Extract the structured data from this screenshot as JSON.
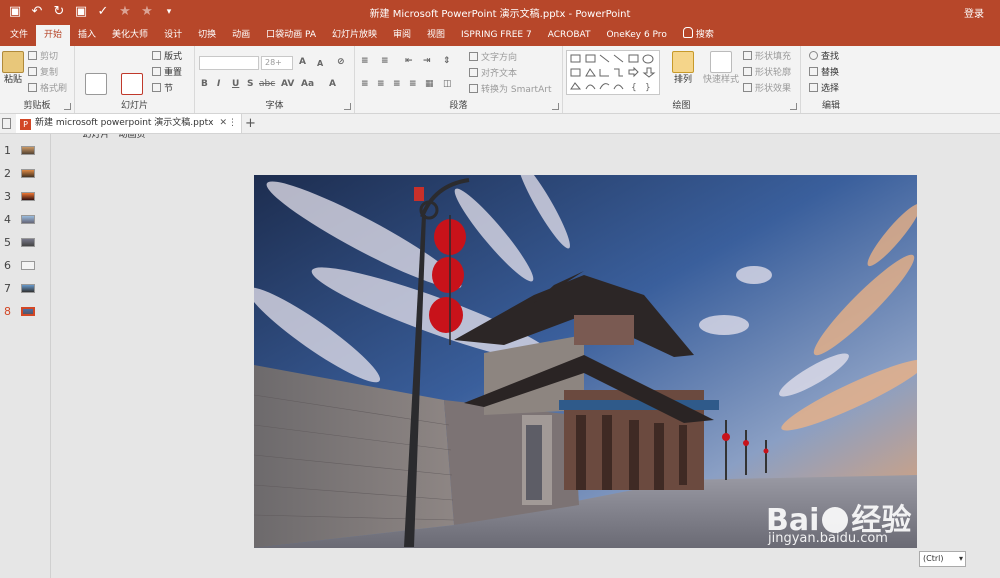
{
  "window": {
    "title": "新建 Microsoft PowerPoint 演示文稿.pptx  -  PowerPoint",
    "login": "登录"
  },
  "qat": {
    "save": "▣",
    "undo": "↶",
    "redo": "↻"
  },
  "tabs": [
    "文件",
    "开始",
    "插入",
    "美化大师",
    "设计",
    "切换",
    "动画",
    "口袋动画 PA",
    "幻灯片放映",
    "审阅",
    "视图",
    "ISPRING FREE 7",
    "ACROBAT",
    "OneKey 6 Pro",
    "搜索"
  ],
  "ribbon": {
    "clipboard": {
      "paste": "粘贴",
      "cut": "剪切",
      "copy": "复制",
      "format_painter": "格式刷",
      "label": "剪贴板"
    },
    "slides": {
      "new_slide": "新建\n幻灯片",
      "add_slide": "新加\n动画页",
      "layout": "版式",
      "reset": "重置",
      "section": "节",
      "label": "幻灯片"
    },
    "font": {
      "size": "28+",
      "bold": "B",
      "italic": "I",
      "underline": "U",
      "strike": "S",
      "shadow": "abc",
      "spacing": "AV",
      "case": "Aa",
      "color": "A",
      "grow": "A",
      "shrink": "A",
      "label": "字体"
    },
    "paragraph": {
      "text_direction": "文字方向",
      "align_text": "对齐文本",
      "smartart": "转换为 SmartArt",
      "label": "段落"
    },
    "drawing": {
      "arrange": "排列",
      "quick_styles": "快速样式",
      "fill": "形状填充",
      "outline": "形状轮廓",
      "effects": "形状效果",
      "label": "绘图"
    },
    "editing": {
      "find": "查找",
      "replace": "替换",
      "select": "选择",
      "label": "编辑"
    }
  },
  "document_tab": {
    "name": "新建 microsoft powerpoint 演示文稿.pptx",
    "add": "+"
  },
  "thumbnails": [
    {
      "num": "1",
      "selected": false
    },
    {
      "num": "2",
      "selected": false
    },
    {
      "num": "3",
      "selected": false
    },
    {
      "num": "4",
      "selected": false
    },
    {
      "num": "5",
      "selected": false
    },
    {
      "num": "6",
      "selected": false
    },
    {
      "num": "7",
      "selected": false
    },
    {
      "num": "8",
      "selected": true
    }
  ],
  "paste_options": "(Ctrl)",
  "watermark": {
    "brand": "Bai",
    "brand2": "经验",
    "url": "jingyan.baidu.com"
  },
  "colors": {
    "accent": "#b7472a",
    "ribbon": "#f3f3f3",
    "canvas": "#e6e6e6",
    "selected": "#d24726"
  }
}
